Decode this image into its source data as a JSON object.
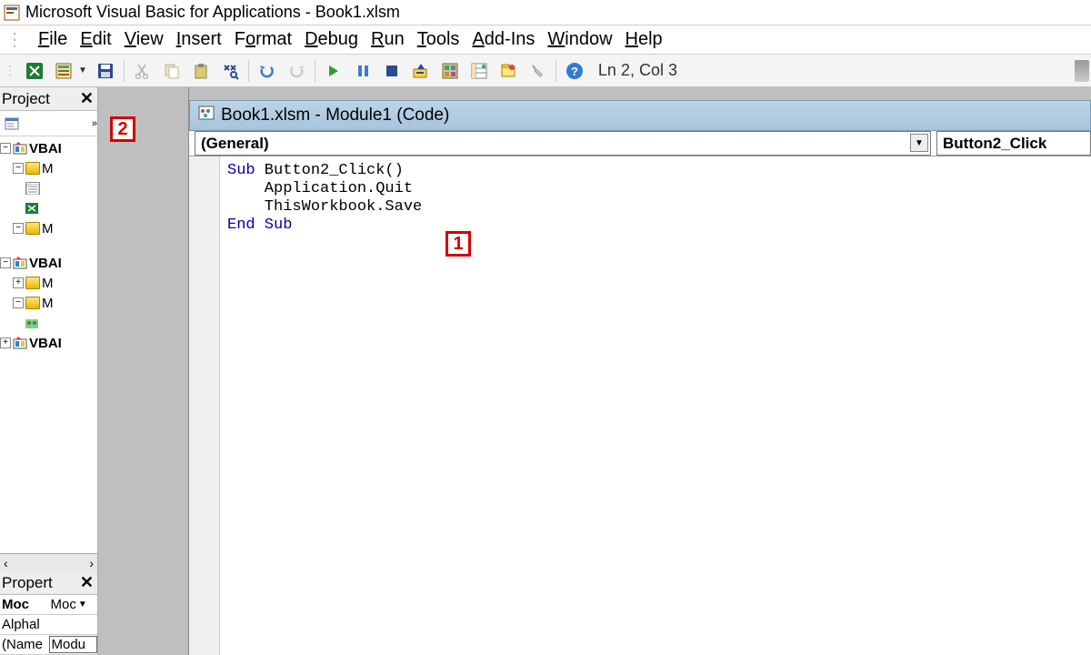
{
  "app": {
    "title": "Microsoft Visual Basic for Applications - Book1.xlsm"
  },
  "menu": {
    "items": [
      {
        "label": "File",
        "accel": "F"
      },
      {
        "label": "Edit",
        "accel": "E"
      },
      {
        "label": "View",
        "accel": "V"
      },
      {
        "label": "Insert",
        "accel": "I"
      },
      {
        "label": "Format",
        "accel": "o"
      },
      {
        "label": "Debug",
        "accel": "D"
      },
      {
        "label": "Run",
        "accel": "R"
      },
      {
        "label": "Tools",
        "accel": "T"
      },
      {
        "label": "Add-Ins",
        "accel": "A"
      },
      {
        "label": "Window",
        "accel": "W"
      },
      {
        "label": "Help",
        "accel": "H"
      }
    ]
  },
  "toolbar": {
    "status": "Ln 2, Col 3",
    "icons": [
      "excel-icon",
      "form-icon",
      "save-icon",
      "cut-icon",
      "copy-icon",
      "paste-icon",
      "find-icon",
      "undo-icon",
      "redo-icon",
      "run-icon",
      "pause-icon",
      "stop-icon",
      "design-icon",
      "project-explorer-icon",
      "properties-icon",
      "object-browser-icon",
      "toolbox-icon",
      "help-icon"
    ]
  },
  "project_panel": {
    "title": "Project",
    "tree": [
      {
        "depth": 0,
        "exp": "-",
        "icon": "vba",
        "label": "VBAI"
      },
      {
        "depth": 1,
        "exp": "-",
        "icon": "folder",
        "label": "M"
      },
      {
        "depth": 2,
        "exp": "",
        "icon": "mod",
        "label": ""
      },
      {
        "depth": 2,
        "exp": "",
        "icon": "mod",
        "label": ""
      },
      {
        "depth": 1,
        "exp": "-",
        "icon": "folder",
        "label": "M"
      },
      {
        "depth": 2,
        "exp": "",
        "icon": "",
        "label": ""
      },
      {
        "depth": 0,
        "exp": "-",
        "icon": "vba",
        "label": "VBAI"
      },
      {
        "depth": 1,
        "exp": "+",
        "icon": "folder",
        "label": "M"
      },
      {
        "depth": 1,
        "exp": "-",
        "icon": "folder",
        "label": "M"
      },
      {
        "depth": 2,
        "exp": "",
        "icon": "mod",
        "label": ""
      },
      {
        "depth": 0,
        "exp": "+",
        "icon": "vba",
        "label": "VBAI"
      }
    ]
  },
  "properties_panel": {
    "title": "Propert",
    "combo_label": "Moc",
    "combo_value": "Moc",
    "rows": [
      {
        "name": "Alphal",
        "value": ""
      },
      {
        "name": "(Name",
        "value": "Modu"
      }
    ]
  },
  "code_window": {
    "title": "Book1.xlsm - Module1 (Code)",
    "left_combo": "(General)",
    "right_combo": "Button2_Click",
    "lines": [
      {
        "kw": "Sub",
        "rest": " Button2_Click()"
      },
      {
        "kw": "",
        "rest": "    Application.Quit"
      },
      {
        "kw": "",
        "rest": "    ThisWorkbook.Save"
      },
      {
        "kw": "End Sub",
        "rest": ""
      }
    ]
  },
  "annotations": {
    "a1": "1",
    "a2": "2"
  }
}
